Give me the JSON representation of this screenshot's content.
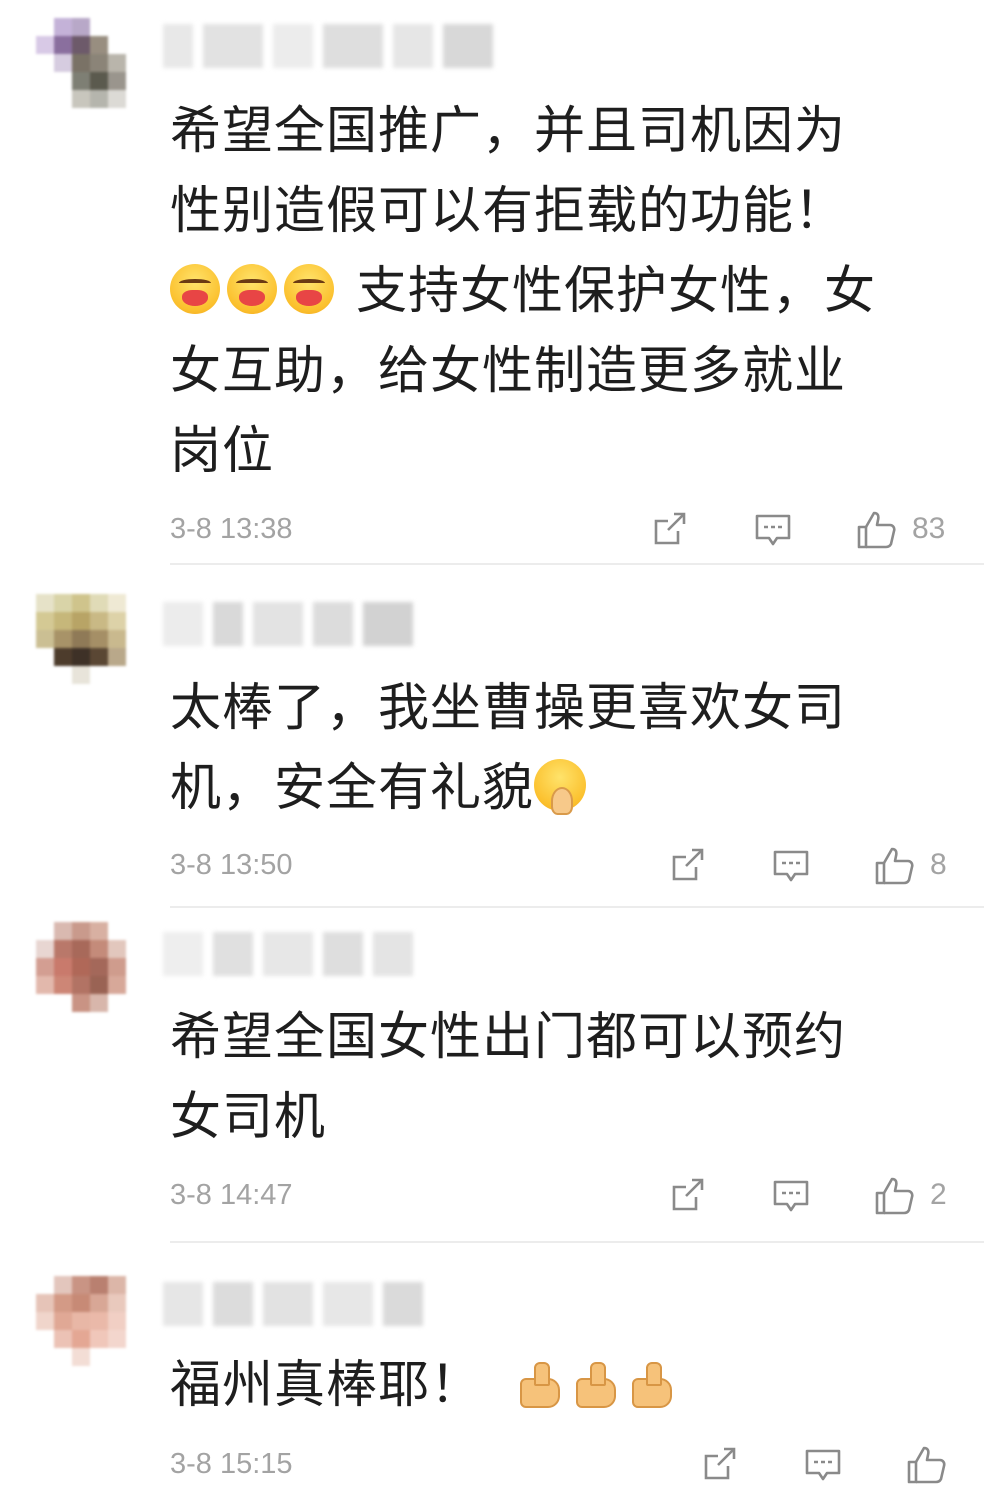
{
  "comments": [
    {
      "body_lines": [
        "希望全国推广，并且司机因为",
        "性别造假可以有拒载的功能！",
        "支持女性保护女性，女",
        "女互助，给女性制造更多就业",
        "岗位"
      ],
      "emoji_before_line3": [
        "hugging-face-emoji",
        "hugging-face-emoji",
        "hugging-face-emoji"
      ],
      "time": "3-8 13:38",
      "likes": "83"
    },
    {
      "body_lines": [
        "太棒了，我坐曹操更喜欢女司",
        "机，安全有礼貌"
      ],
      "emoji_after_line2": "pleading-hands-face-emoji",
      "time": "3-8 13:50",
      "likes": "8"
    },
    {
      "body_lines": [
        "希望全国女性出门都可以预约",
        "女司机"
      ],
      "time": "3-8 14:47",
      "likes": "2"
    },
    {
      "body_lines": [
        "福州真棒耶！"
      ],
      "emoji_after_line1": [
        "thumbs-up-emoji",
        "thumbs-up-emoji",
        "thumbs-up-emoji"
      ],
      "time": "3-8 15:15",
      "likes": ""
    }
  ],
  "icons": {
    "share": "share-icon",
    "reply": "reply-icon",
    "like": "thumbs-up-icon"
  },
  "colors": {
    "meta_text": "#a3a3a3",
    "body_text": "#1e1e1e",
    "divider": "#ececec"
  }
}
